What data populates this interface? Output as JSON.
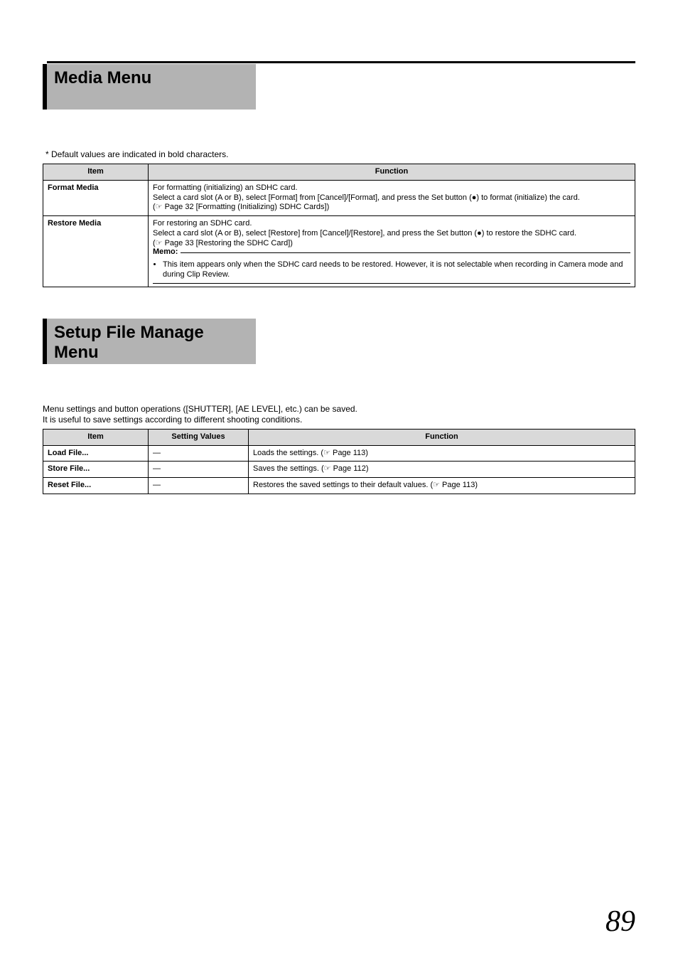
{
  "page_number": "89",
  "note": "* Default values are indicated in bold characters.",
  "sections": {
    "media": {
      "title": "Media Menu",
      "headers": {
        "item": "Item",
        "func": "Function"
      },
      "rows": {
        "format": {
          "item": "Format Media",
          "line1": "For formatting (initializing) an SDHC card.",
          "line2a": "Select a card slot (A or B), select [Format] from [Cancel]/[Format], and press the Set button (",
          "line2b": ") to format (initialize) the card.",
          "ref": "(☞ Page 32 [Formatting (Initializing) SDHC Cards])"
        },
        "restore": {
          "item": "Restore Media",
          "line1": "For restoring an SDHC card.",
          "line2a": "Select a card slot (A or B), select [Restore] from [Cancel]/[Restore], and press the Set button (",
          "line2b": ") to restore the SDHC card.",
          "ref": "(☞ Page 33 [Restoring the SDHC Card])",
          "memo_label": "Memo:",
          "memo_item": "This item appears only when the SDHC card needs to be restored. However, it is not selectable when recording in Camera mode and during Clip Review."
        }
      }
    },
    "setup": {
      "title": "Setup File Manage Menu",
      "intro1": "Menu settings and button operations ([SHUTTER], [AE LEVEL], etc.) can be saved.",
      "intro2": "It is useful to save settings according to different shooting conditions.",
      "headers": {
        "item": "Item",
        "sv": "Setting Values",
        "func": "Function"
      },
      "rows": {
        "load": {
          "item": "Load File...",
          "sv": "—",
          "func_pre": "Loads the settings. (☞  Page 113)"
        },
        "store": {
          "item": "Store File...",
          "sv": "—",
          "func_pre": "Saves the settings. (☞  Page 112)"
        },
        "reset": {
          "item": "Reset File...",
          "sv": "—",
          "func_pre": "Restores the saved settings to their default values. (☞  Page 113)"
        }
      }
    }
  }
}
